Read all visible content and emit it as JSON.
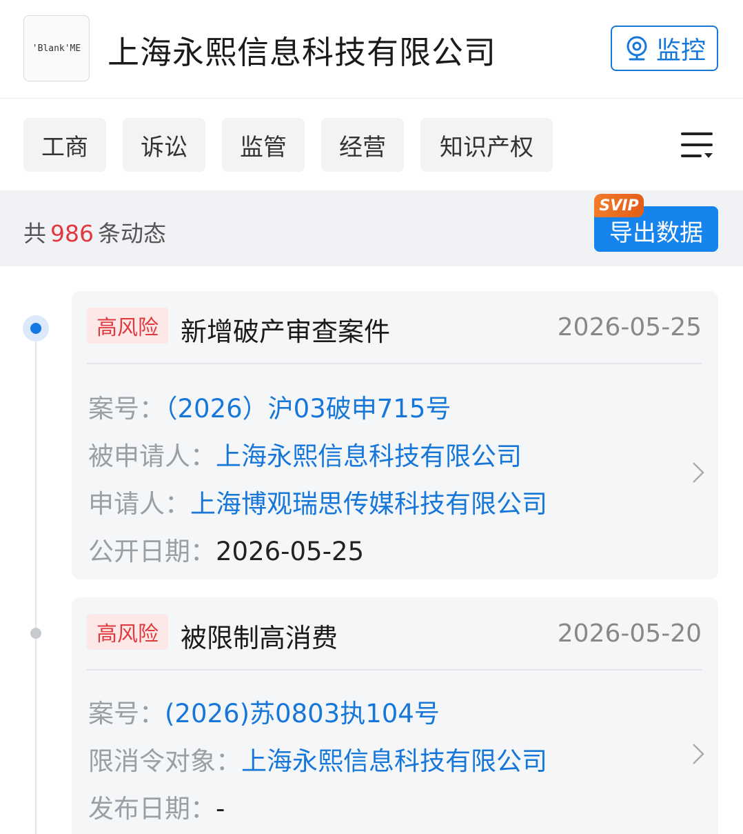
{
  "header": {
    "logo_text": "'Blank'ME",
    "company_name": "上海永熙信息科技有限公司",
    "monitor_label": "监控"
  },
  "tabs": [
    {
      "label": "工商"
    },
    {
      "label": "诉讼"
    },
    {
      "label": "监管"
    },
    {
      "label": "经营"
    },
    {
      "label": "知识产权"
    }
  ],
  "summary": {
    "prefix": "共",
    "count": "986",
    "suffix": "条动态",
    "export_label": "导出数据",
    "svip_badge": "SVIP"
  },
  "events": [
    {
      "risk": "高风险",
      "title": "新增破产审查案件",
      "date": "2026-05-25",
      "fields": [
        {
          "label": "案号：",
          "value": "（2026）沪03破申715号"
        },
        {
          "label": "被申请人：",
          "value": "上海永熙信息科技有限公司"
        },
        {
          "label": "申请人：",
          "value": "上海博观瑞思传媒科技有限公司"
        },
        {
          "label": "公开日期：",
          "value": "2026-05-25"
        }
      ]
    },
    {
      "risk": "高风险",
      "title": "被限制高消费",
      "date": "2026-05-20",
      "fields": [
        {
          "label": "案号：",
          "value": "(2026)苏0803执104号"
        },
        {
          "label": "限消令对象：",
          "value": "上海永熙信息科技有限公司"
        },
        {
          "label": "发布日期：",
          "value": "-"
        }
      ]
    }
  ],
  "colors": {
    "accent": "#1677d9",
    "risk": "#e0393e",
    "svip": "#e86a20"
  }
}
